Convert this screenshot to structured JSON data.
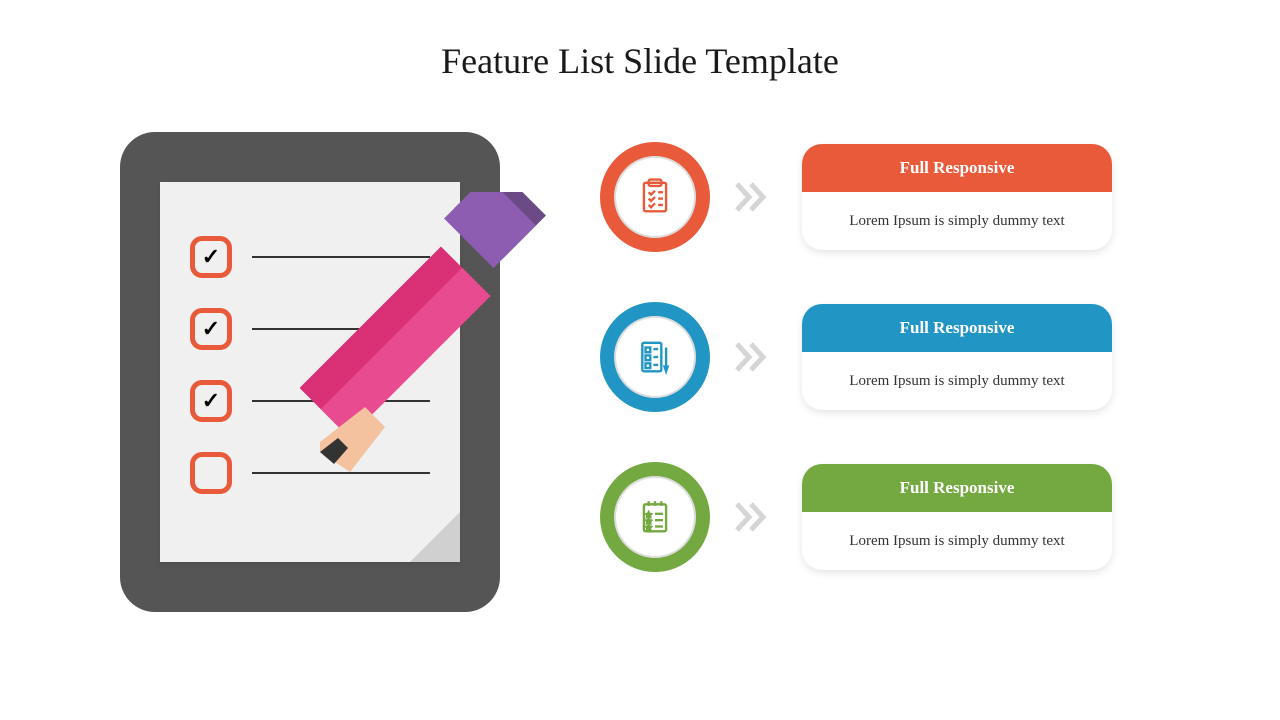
{
  "title": "Feature List Slide Template",
  "colors": {
    "orange": "#e85a3a",
    "blue": "#2196c4",
    "green": "#74a941",
    "tablet": "#555555",
    "pencilBody": "#d93076",
    "pencilEraser": "#8c5db0",
    "arrow": "#d5d5d5"
  },
  "features": [
    {
      "title": "Full Responsive",
      "description": "Lorem Ipsum is simply dummy text",
      "color": "#e85a3a",
      "icon": "clipboard-check-icon"
    },
    {
      "title": "Full Responsive",
      "description": "Lorem Ipsum is simply dummy text",
      "color": "#2196c4",
      "icon": "document-pencil-icon"
    },
    {
      "title": "Full Responsive",
      "description": "Lorem Ipsum is simply dummy text",
      "color": "#74a941",
      "icon": "notepad-star-icon"
    }
  ],
  "checklist": {
    "items": [
      {
        "checked": true
      },
      {
        "checked": true
      },
      {
        "checked": true
      },
      {
        "checked": false
      }
    ]
  }
}
